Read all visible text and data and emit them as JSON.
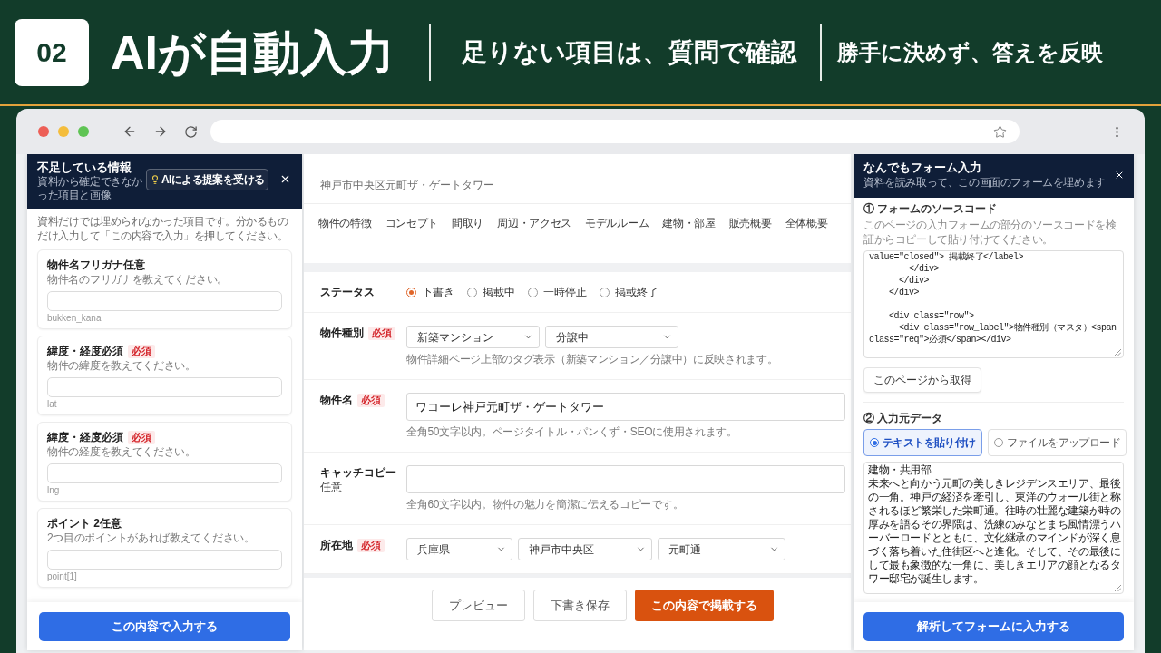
{
  "header": {
    "badge": "02",
    "title": "AIが自動入力",
    "taglines": [
      "足りない項目は、質問で確認",
      "勝手に決めず、答えを反映"
    ]
  },
  "missing_panel": {
    "title": "不足している情報",
    "subtitle": "資料から確定できなかった項目と画像",
    "suggest_button": "AIによる提案を受ける",
    "intro": "資料だけでは埋められなかった項目です。分かるものだけ入力して「この内容で入力」を押してください。",
    "items": [
      {
        "title": "物件名フリガナ任意",
        "hint": "物件名のフリガナを教えてください。",
        "key": "bukken_kana"
      },
      {
        "title": "緯度・経度必須",
        "badge": "必須",
        "hint": "物件の緯度を教えてください。",
        "key": "lat"
      },
      {
        "title": "緯度・経度必須",
        "badge": "必須",
        "hint": "物件の経度を教えてください。",
        "key": "lng"
      },
      {
        "title": "ポイント 2任意",
        "hint": "2つ目のポイントがあれば教えてください。",
        "key": "point[1]"
      }
    ],
    "submit_button": "この内容で入力する"
  },
  "page": {
    "breadcrumb": "神戸市中央区元町ザ・ゲートタワー",
    "tabs": [
      "物件の特徴",
      "コンセプト",
      "間取り",
      "周辺・アクセス",
      "モデルルーム",
      "建物・部屋",
      "販売概要",
      "全体概要"
    ],
    "rows": [
      {
        "kind": "radio",
        "label": "ステータス",
        "options": [
          {
            "label": "下書き",
            "selected": true
          },
          {
            "label": "掲載中",
            "selected": false
          },
          {
            "label": "一時停止",
            "selected": false
          },
          {
            "label": "掲載終了",
            "selected": false
          }
        ]
      },
      {
        "kind": "select",
        "label": "物件種別",
        "badge": "必須",
        "selects": [
          "新築マンション",
          "分譲中"
        ],
        "hint": "物件詳細ページ上部のタグ表示（新築マンション／分譲中）に反映されます。"
      },
      {
        "kind": "text",
        "label": "物件名",
        "badge": "必須",
        "value": "ワコーレ神戸元町ザ・ゲートタワー",
        "hint": "全角50文字以内。ページタイトル・パンくず・SEOに使用されます。"
      },
      {
        "kind": "text",
        "label": "キャッチコピー",
        "sublabel": "任意",
        "hint": "全角60文字以内。物件の魅力を簡潔に伝えるコピーです。"
      },
      {
        "kind": "select",
        "label": "所在地",
        "badge": "必須",
        "selects": [
          "兵庫県",
          "神戸市中央区",
          "元町通"
        ]
      }
    ],
    "buttons": [
      {
        "label": "プレビュー",
        "kind": "secondary"
      },
      {
        "label": "下書き保存",
        "kind": "secondary"
      },
      {
        "label": "この内容で掲載する",
        "kind": "primary"
      }
    ]
  },
  "form_panel": {
    "title": "なんでもフォーム入力",
    "subtitle": "資料を読み取って、この画面のフォームを埋めます",
    "source_label": "① フォームのソースコード",
    "source_hint": "このページの入力フォームの部分のソースコードを検証からコピーして貼り付けてください。",
    "source_code": "value=\"closed\"> 掲載終了</label>\n        </div>\n      </div>\n    </div>\n\n    <div class=\"row\">\n      <div class=\"row_label\">物件種別（マスタ）<span\nclass=\"req\">必須</span></div>",
    "fetch_button": "このページから取得",
    "input_label": "② 入力元データ",
    "input_modes": [
      {
        "label": "テキストを貼り付け",
        "selected": true
      },
      {
        "label": "ファイルをアップロード",
        "selected": false
      }
    ],
    "input_lines": [
      "建物・共用部",
      "未来へと向かう元町の美しきレジデンスエリア、最後の一角。神戸の経済を牽引し、東洋のウォール街と称されるほど繁栄した栄町通。往時の壮麗な建築が時の厚みを語るその界隈は、洗練のみなとまち風情漂うハーバーロードとともに、文化継承のマインドが深く息づく落ち着いた住街区へと進化。そして、その最後にして最も象徴的な一角に、美しきエリアの顔となるタワー邸宅が誕生します。"
    ],
    "submit_button": "解析してフォームに入力する"
  }
}
